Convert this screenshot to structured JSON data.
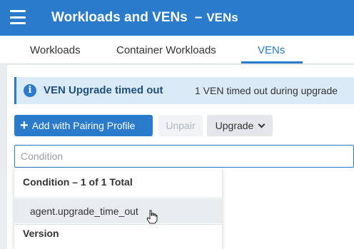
{
  "header": {
    "title": "Workloads and VENs",
    "separator": "–",
    "subtitle": "VENs"
  },
  "tabs": [
    {
      "label": "Workloads",
      "active": false
    },
    {
      "label": "Container Workloads",
      "active": false
    },
    {
      "label": "VENs",
      "active": true
    }
  ],
  "banner": {
    "title": "VEN Upgrade timed out",
    "message": "1 VEN timed out during upgrade",
    "icon": "info-icon"
  },
  "toolbar": {
    "add_label": "Add with Pairing Profile",
    "unpair_label": "Unpair",
    "upgrade_label": "Upgrade"
  },
  "search": {
    "placeholder": "Condition"
  },
  "dropdown": {
    "group_header": "Condition – 1 of 1 Total",
    "items": [
      "agent.upgrade_time_out"
    ],
    "next_group_header": "Version"
  },
  "colors": {
    "accent": "#2a7bcb",
    "banner_bg": "#dbeaf7"
  }
}
